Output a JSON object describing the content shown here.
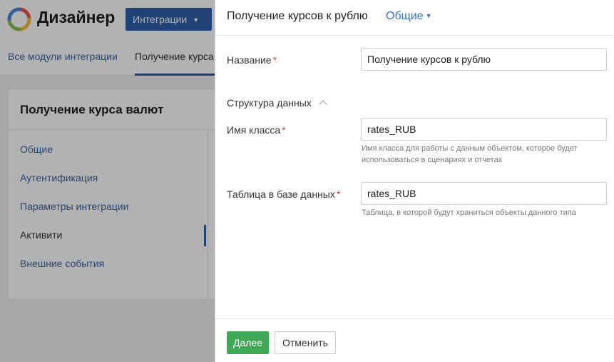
{
  "app": {
    "name": "Дизайнер",
    "menu_button": "Интеграции"
  },
  "tabs": [
    {
      "label": "Все модули интеграции"
    },
    {
      "label": "Получение курса"
    }
  ],
  "card": {
    "title": "Получение курса валют",
    "items": [
      {
        "label": "Общие"
      },
      {
        "label": "Аутентификация"
      },
      {
        "label": "Параметры интеграции"
      },
      {
        "label": "Активити"
      },
      {
        "label": "Внешние события"
      }
    ],
    "active_item": "Активити"
  },
  "panel": {
    "title": "Получение курсов к рублю",
    "mode": "Общие",
    "fields": {
      "name": {
        "label": "Название",
        "value": "Получение курсов к рублю",
        "required_mark": "*"
      },
      "section": "Структура данных",
      "class_name": {
        "label": "Имя класса",
        "value": "rates_RUB",
        "required_mark": "*",
        "hint": "Имя класса для работы с данным объектом, которое будет использоваться в сценариях и отчетах"
      },
      "db_table": {
        "label": "Таблица в базе данных",
        "value": "rates_RUB",
        "required_mark": "*",
        "hint": "Таблица, в которой будут храниться объекты данного типа"
      }
    },
    "footer": {
      "next_label": "Далее",
      "cancel_label": "Отменить"
    }
  },
  "colors": {
    "accent_blue": "#2e5ea8",
    "link_blue": "#3a63a6",
    "success_green": "#3ea857",
    "required_red": "#e53935"
  }
}
